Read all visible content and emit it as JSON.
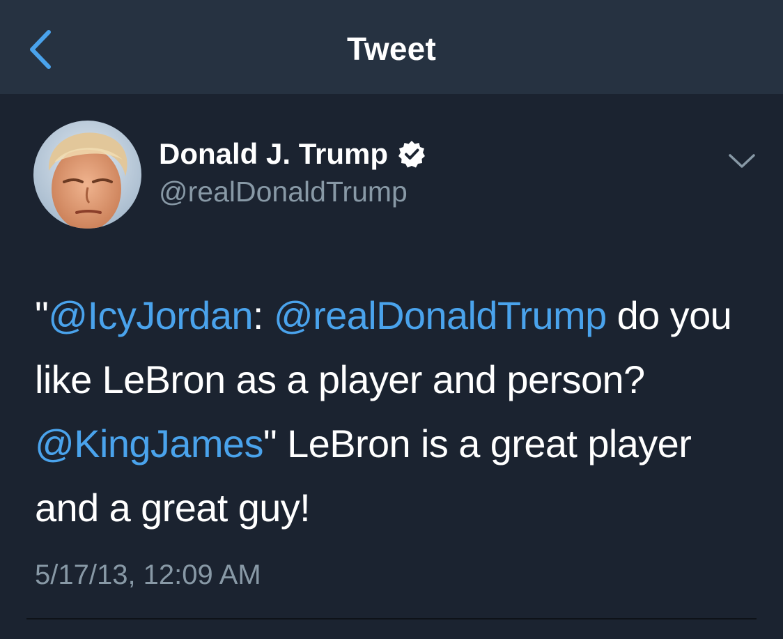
{
  "nav": {
    "title": "Tweet",
    "back_icon": "chevron-left-icon"
  },
  "colors": {
    "nav_background": "#263241",
    "page_background": "#1b2330",
    "accent_blue": "#4aa3ec",
    "secondary_text": "#8899a6"
  },
  "tweet": {
    "author": {
      "display_name": "Donald J. Trump",
      "handle": "@realDonaldTrump",
      "verified": true,
      "verified_icon": "verified-badge-icon"
    },
    "menu_icon": "chevron-down-icon",
    "text": {
      "quote_open": "\"",
      "mention_1": "@IcyJordan",
      "sep_1": ": ",
      "mention_2": "@realDonaldTrump",
      "segment_1": " do you like LeBron as a player and person? ",
      "mention_3": "@KingJames",
      "segment_2": "\"  LeBron is a great player and a great guy!"
    },
    "timestamp": "5/17/13, 12:09 AM"
  }
}
